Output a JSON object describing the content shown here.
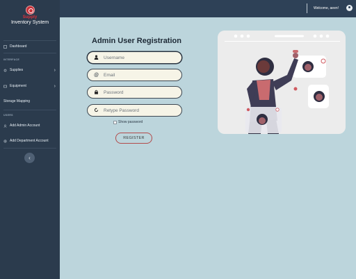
{
  "brand": {
    "name": "Supply",
    "subtitle": "Inventory System"
  },
  "sidebar": {
    "sections": {
      "interface": "INTERFACE",
      "users": "USERS"
    },
    "items": [
      {
        "label": "Dashboard",
        "icon": "dashboard-icon"
      },
      {
        "label": "Supplies",
        "icon": "supplies-icon"
      },
      {
        "label": "Equipment",
        "icon": "equipment-icon"
      },
      {
        "label": "Storage Mapping",
        "icon": "none"
      },
      {
        "label": "Add Admin Account",
        "icon": "add-admin-icon"
      },
      {
        "label": "Add Department Account",
        "icon": "add-department-icon"
      }
    ],
    "collapse_glyph": "‹"
  },
  "topbar": {
    "welcome": "Welcome, aeen!"
  },
  "form": {
    "title": "Admin User Registration",
    "fields": [
      {
        "placeholder": "Username",
        "icon": "user-icon",
        "glyph": "👤"
      },
      {
        "placeholder": "Email",
        "icon": "at-icon",
        "glyph": "@"
      },
      {
        "placeholder": "Password",
        "icon": "lock-icon",
        "glyph": "🔒"
      },
      {
        "placeholder": "Retype Password",
        "icon": "refresh-icon",
        "glyph": "⟳"
      }
    ],
    "show_password": "Show password",
    "register": "REGISTER"
  },
  "colors": {
    "sidebar": "#2b3b4d",
    "topbar": "#2e4157",
    "background": "#bcd5dc",
    "accent": "#c9323a",
    "field_bg": "#f6f4e7"
  }
}
